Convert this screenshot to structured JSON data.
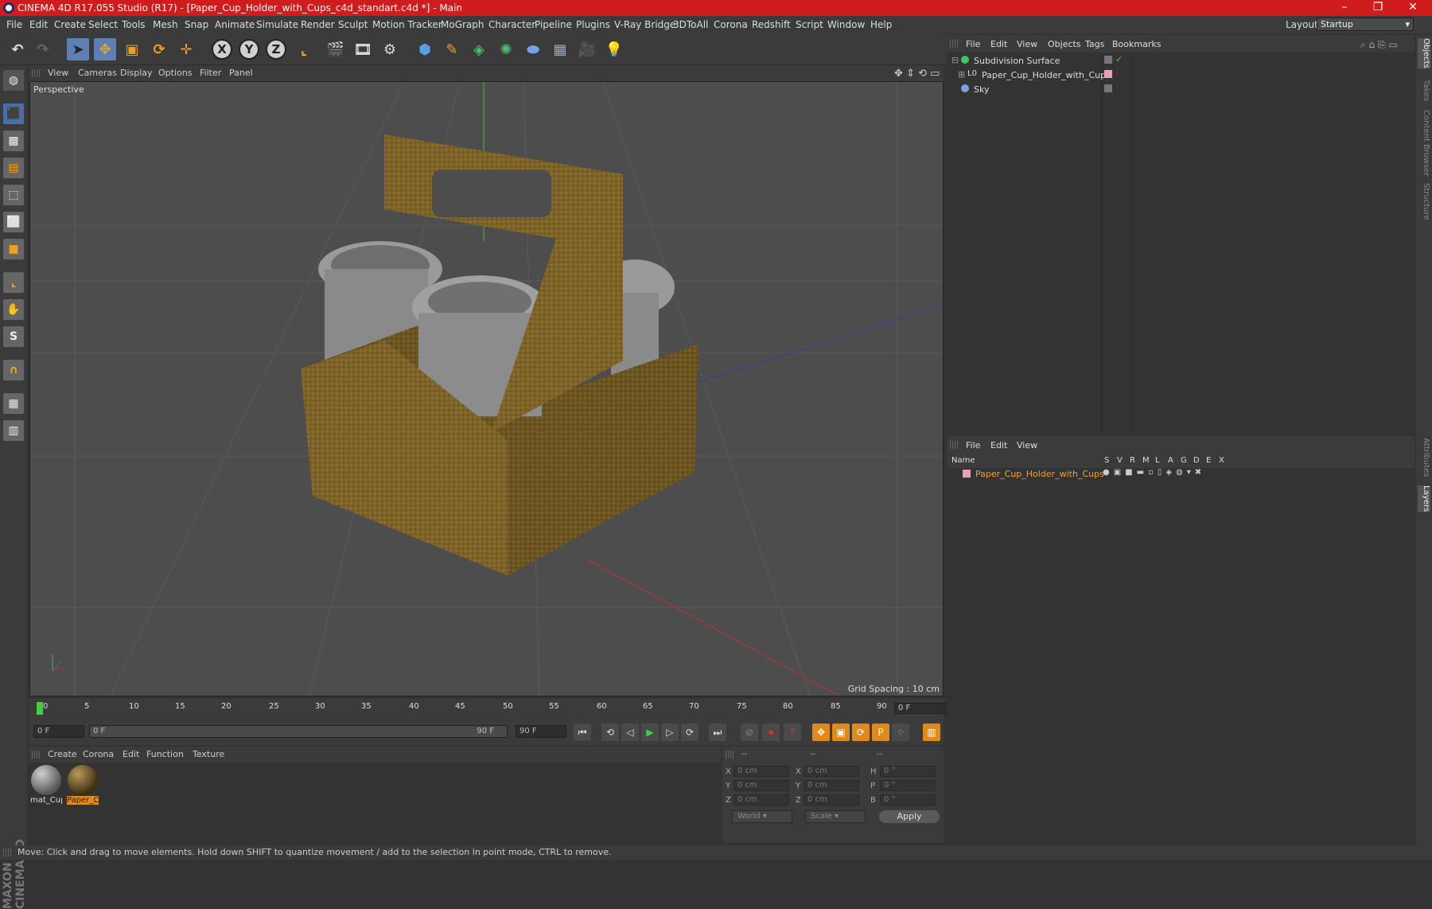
{
  "window": {
    "title": "CINEMA 4D R17.055 Studio (R17) - [Paper_Cup_Holder_with_Cups_c4d_standart.c4d *] - Main",
    "controls": [
      "–",
      "❐",
      "✕"
    ]
  },
  "menubar": {
    "items": [
      "File",
      "Edit",
      "Create",
      "Select",
      "Tools",
      "Mesh",
      "Snap",
      "Animate",
      "Simulate",
      "Render",
      "Sculpt",
      "Motion Tracker",
      "MoGraph",
      "Character",
      "Pipeline",
      "Plugins",
      "V-Ray Bridge",
      "3DToAll",
      "Corona",
      "Redshift",
      "Script",
      "Window",
      "Help"
    ],
    "layout_label": "Layout:",
    "layout_value": "Startup"
  },
  "toolbar": {
    "axis_x": "X",
    "axis_y": "Y",
    "axis_z": "Z"
  },
  "viewport": {
    "menu": [
      "View",
      "Cameras",
      "Display",
      "Options",
      "Filter",
      "Panel"
    ],
    "label": "Perspective",
    "grid_spacing": "Grid Spacing : 10 cm"
  },
  "timeline": {
    "ticks": [
      "0",
      "5",
      "10",
      "15",
      "20",
      "25",
      "30",
      "35",
      "40",
      "45",
      "50",
      "55",
      "60",
      "65",
      "70",
      "75",
      "80",
      "85",
      "90"
    ],
    "current_frame": "0 F",
    "start_field": "0 F",
    "range_start": "0 F",
    "range_end": "90 F",
    "end_field": "90 F"
  },
  "materials": {
    "menu": [
      "Create",
      "Corona",
      "Edit",
      "Function",
      "Texture"
    ],
    "items": [
      {
        "label": "mat_Cup",
        "color": "#8a8a8a"
      },
      {
        "label": "Paper_C",
        "color": "#7a5f2c"
      }
    ]
  },
  "coords": {
    "headers": [
      "--",
      "--",
      "--"
    ],
    "rows": [
      {
        "a": "X",
        "av": "0 cm",
        "b": "X",
        "bv": "0 cm",
        "c": "H",
        "cv": "0 °"
      },
      {
        "a": "Y",
        "av": "0 cm",
        "b": "Y",
        "bv": "0 cm",
        "c": "P",
        "cv": "0 °"
      },
      {
        "a": "Z",
        "av": "0 cm",
        "b": "Z",
        "bv": "0 cm",
        "c": "B",
        "cv": "0 °"
      }
    ],
    "world": "World",
    "scale": "Scale",
    "apply": "Apply"
  },
  "objects_panel": {
    "menu": [
      "File",
      "Edit",
      "View",
      "Objects",
      "Tags",
      "Bookmarks"
    ],
    "items": [
      {
        "name": "Subdivision Surface"
      },
      {
        "name": "Paper_Cup_Holder_with_Cups"
      },
      {
        "name": "Sky"
      }
    ]
  },
  "layers_panel": {
    "menu": [
      "File",
      "Edit",
      "View"
    ],
    "columns": [
      "Name",
      "S",
      "V",
      "R",
      "M",
      "L",
      "A",
      "G",
      "D",
      "E",
      "X"
    ],
    "row_name": "Paper_Cup_Holder_with_Cups"
  },
  "right_tabs": [
    "Objects",
    "Takes",
    "Content Browser",
    "Structure",
    "Attributes",
    "Layers"
  ],
  "status": "Move: Click and drag to move elements. Hold down SHIFT to quantize movement / add to the selection in point mode, CTRL to remove.",
  "brand": "MAXON CINEMA 4D"
}
